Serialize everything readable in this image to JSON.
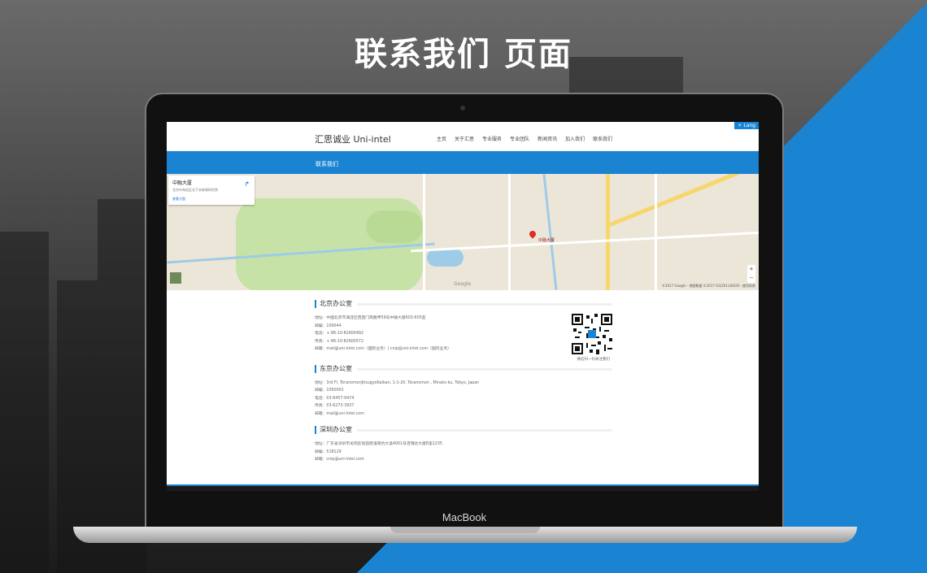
{
  "headline": "联系我们 页面",
  "device_label": "MacBook",
  "site": {
    "lang_button": "+ Lang",
    "brand": "汇思诚业 Uni-intel",
    "nav": [
      "主页",
      "关于汇思",
      "专业服务",
      "专业团队",
      "新闻资讯",
      "加入我们",
      "联系我们"
    ],
    "banner_title": "联系我们"
  },
  "map": {
    "card_title": "中融大厦",
    "card_address": "北京市海淀区北下关邮政研究院",
    "card_link": "查看大图",
    "directions_label": "路线",
    "pin_label": "中融大厦",
    "google": "Google",
    "footer": "©2017 Google · 地图数据 ©2017 GS(2011)6020 · 使用条款",
    "zoom_in": "+",
    "zoom_out": "−"
  },
  "offices": [
    {
      "title": "北京办公室",
      "lines": [
        "地址：中国北京市海淀区西直门南路甲59号中融大厦603-605室",
        "邮编：100044",
        "电话：+ 86-10-82600492",
        "传真：+ 86-10-82600572",
        "邮箱：mail@uni-intel.com（国际业务）| cnip@uni-intel.com（国内业务）"
      ],
      "qr_caption": "微信扫一扫关注我们"
    },
    {
      "title": "东京办公室",
      "lines": [
        "地址：3rd Fl. ToranomonJitsugyoKaikan, 1-1-20, Toranomon , Minato-ku, Tokyo, Japan",
        "邮编：1050001",
        "电话：03-6457-9474",
        "传真：03-6273-3937",
        "邮箱：mail@uni-intel.com"
      ]
    },
    {
      "title": "深圳办公室",
      "lines": [
        "地址：广东省深圳市龙岗区坂田街道南坑大道4001号百瑞达大厦E座1235",
        "邮编：518129",
        "邮箱：cnip@uni-intel.com"
      ]
    }
  ],
  "colors": {
    "accent": "#1a84d3",
    "bg_dark": "#2b2b2b"
  }
}
